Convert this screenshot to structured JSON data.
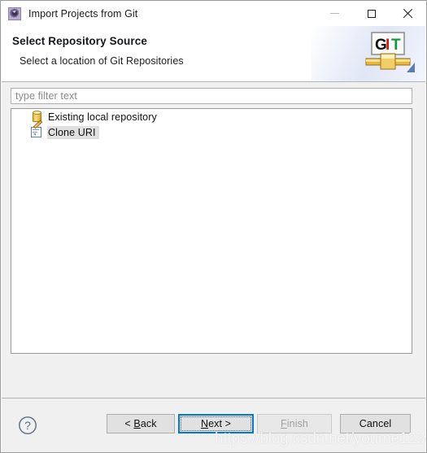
{
  "window": {
    "title": "Import Projects from Git",
    "app_icon": "eclipse-gear-icon",
    "controls": {
      "minimize": "minimize-icon",
      "maximize": "maximize-icon",
      "close": "close-icon"
    }
  },
  "header": {
    "title": "Select Repository Source",
    "subtitle": "Select a location of Git Repositories",
    "logo": {
      "letters": [
        "G",
        "I",
        "T"
      ],
      "colors": [
        "#111111",
        "#cc1a1a",
        "#119933"
      ]
    }
  },
  "filter": {
    "placeholder": "type filter text",
    "value": ""
  },
  "list": {
    "items": [
      {
        "label": "Existing local repository",
        "icon": "repository-cylinder-icon",
        "selected": false
      },
      {
        "label": "Clone URI",
        "icon": "clone-uri-page-pencil-icon",
        "selected": true
      }
    ]
  },
  "buttons": {
    "help": "?",
    "back": {
      "prefix": "< ",
      "mnemonic": "B",
      "rest": "ack",
      "enabled": true
    },
    "next": {
      "mnemonic": "N",
      "rest": "ext",
      "suffix": " >",
      "enabled": true,
      "focused": true
    },
    "finish": {
      "mnemonic": "F",
      "rest": "inish",
      "enabled": false
    },
    "cancel": {
      "label": "Cancel",
      "enabled": true
    }
  },
  "watermark": {
    "text": "https://blog.csdn.net/youme123456"
  },
  "colors": {
    "accent_focus": "#0078d7",
    "dialog_bg": "#f0f0f0",
    "list_bg": "#ffffff",
    "selection_bg": "#e0e0e0",
    "placeholder": "#8b8b8b"
  }
}
